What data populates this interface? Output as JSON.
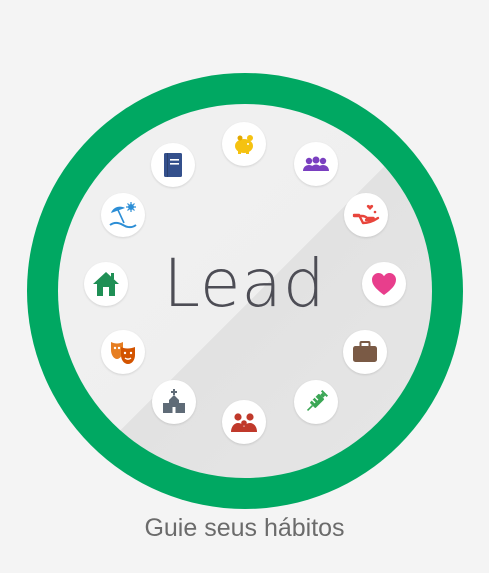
{
  "app": {
    "title": "Lead",
    "tagline": "Guie seus hábitos"
  },
  "colors": {
    "ring": "#00a862",
    "brand_text": "#4d4d55",
    "tagline_text": "#6b6b6b"
  },
  "habits": [
    {
      "icon": "piggy-bank-icon",
      "color": "#f5c211"
    },
    {
      "icon": "group-icon",
      "color": "#7a3fc0"
    },
    {
      "icon": "charity-hand-icon",
      "color": "#e8453c"
    },
    {
      "icon": "heart-icon",
      "color": "#e83e8c"
    },
    {
      "icon": "briefcase-icon",
      "color": "#7a5a45"
    },
    {
      "icon": "syringe-icon",
      "color": "#3aa655"
    },
    {
      "icon": "family-icon",
      "color": "#c0392b"
    },
    {
      "icon": "church-icon",
      "color": "#5f6b77"
    },
    {
      "icon": "theater-masks-icon",
      "color": "#e67e22"
    },
    {
      "icon": "home-icon",
      "color": "#1f8f55"
    },
    {
      "icon": "beach-icon",
      "color": "#2c8ed6"
    },
    {
      "icon": "book-icon",
      "color": "#34508c"
    }
  ]
}
